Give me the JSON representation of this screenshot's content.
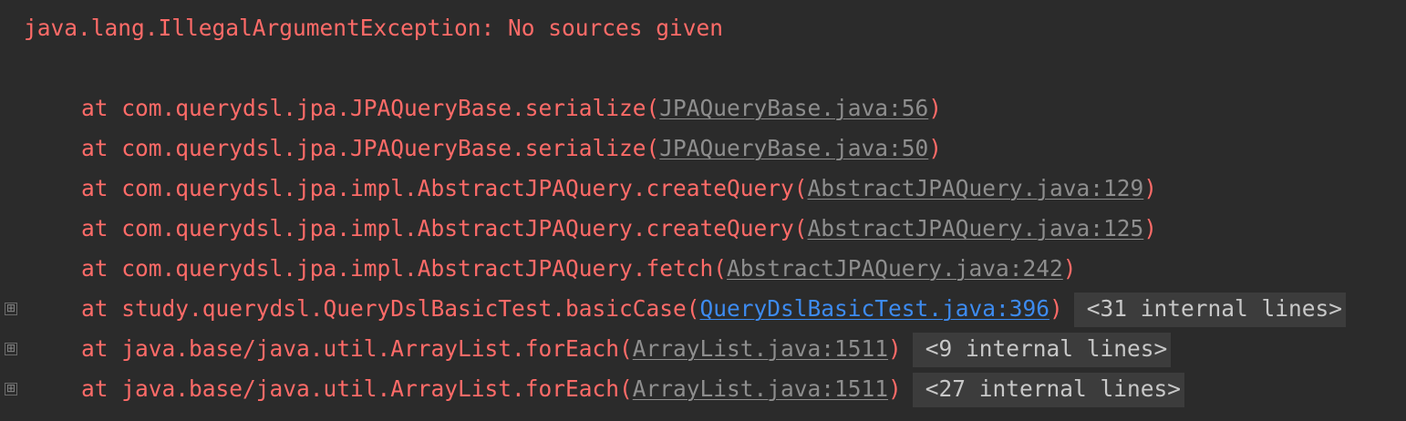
{
  "exception": "java.lang.IllegalArgumentException: No sources given",
  "frames": [
    {
      "prefix": "at com.querydsl.jpa.JPAQueryBase.serialize(",
      "link": "JPAQueryBase.java:56",
      "suffix": ")"
    },
    {
      "prefix": "at com.querydsl.jpa.JPAQueryBase.serialize(",
      "link": "JPAQueryBase.java:50",
      "suffix": ")"
    },
    {
      "prefix": "at com.querydsl.jpa.impl.AbstractJPAQuery.createQuery(",
      "link": "AbstractJPAQuery.java:129",
      "suffix": ")"
    },
    {
      "prefix": "at com.querydsl.jpa.impl.AbstractJPAQuery.createQuery(",
      "link": "AbstractJPAQuery.java:125",
      "suffix": ")"
    },
    {
      "prefix": "at com.querydsl.jpa.impl.AbstractJPAQuery.fetch(",
      "link": "AbstractJPAQuery.java:242",
      "suffix": ")"
    },
    {
      "prefix": "at study.querydsl.QueryDslBasicTest.basicCase(",
      "link": "QueryDslBasicTest.java:396",
      "suffix": ")",
      "fold": "<31 internal lines>"
    },
    {
      "prefix": "at java.base/java.util.ArrayList.forEach(",
      "link": "ArrayList.java:1511",
      "suffix": ")",
      "fold": "<9 internal lines>"
    },
    {
      "prefix": "at java.base/java.util.ArrayList.forEach(",
      "link": "ArrayList.java:1511",
      "suffix": ")",
      "fold": "<27 internal lines>"
    }
  ],
  "gutter_icon": "⊞",
  "colors": {
    "background": "#2b2b2b",
    "error_text": "#ff6b68",
    "link": "#8e8e8e",
    "active_link": "#3d8bf0",
    "fold_background": "#3c3c3c",
    "fold_text": "#c8c8c8"
  },
  "icons": {
    "expand": "plus-square-icon"
  }
}
